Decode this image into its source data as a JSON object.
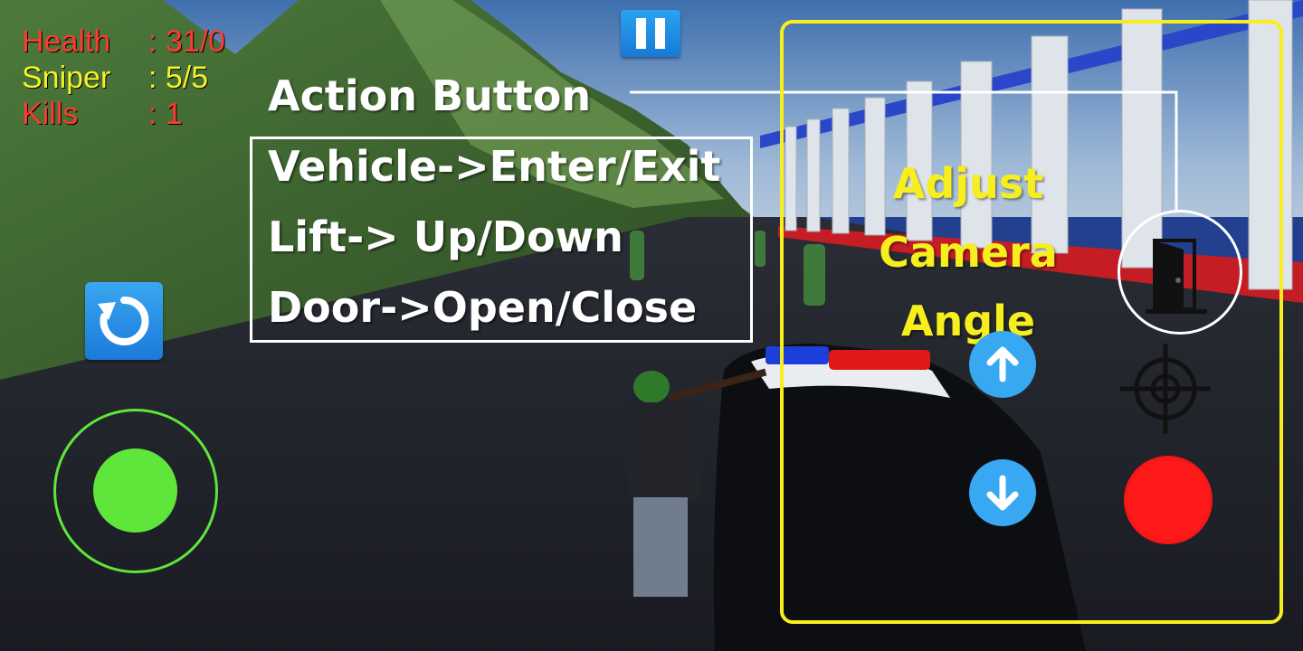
{
  "hud": {
    "health_label": "Health",
    "health_value": ": 31/0",
    "sniper_label": "Sniper",
    "sniper_value": ": 5/5",
    "kills_label": "Kills",
    "kills_value": ": 1"
  },
  "tutorial": {
    "action_title": "Action Button",
    "actions": [
      "Vehicle->Enter/Exit",
      "Lift-> Up/Down",
      "Door->Open/Close"
    ],
    "camera_lines": [
      "Adjust",
      "Camera",
      "Angle"
    ]
  },
  "icons": {
    "pause": "pause-icon",
    "respawn": "refresh-icon",
    "camera_up": "arrow-up-icon",
    "camera_down": "arrow-down-icon",
    "action": "door-icon",
    "aim": "crosshair-icon",
    "fire": "fire-icon"
  },
  "colors": {
    "health": "#ff3b2f",
    "sniper": "#f2f22a",
    "kills": "#ff3b2f",
    "joystick": "#5ee63a",
    "highlight": "#f7ef1d",
    "button_blue": "#2a8fe6",
    "fire": "#ff1a1a"
  }
}
